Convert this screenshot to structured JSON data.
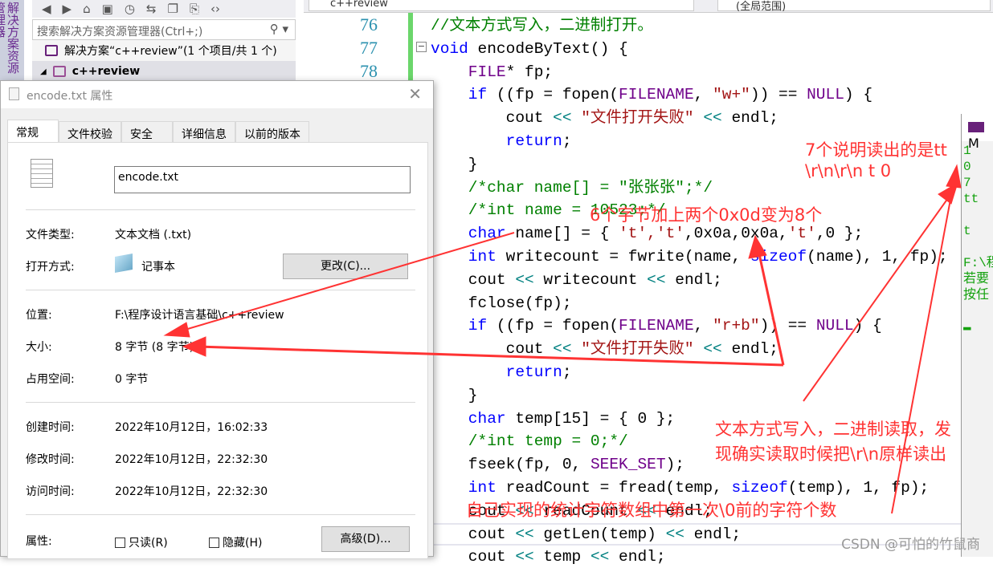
{
  "solution_explorer": {
    "side_label": "解决方案资源管理器",
    "toolbar_icons": [
      "back-icon",
      "forward-icon",
      "home-icon",
      "sync-view-icon",
      "history-icon",
      "switch-icon",
      "collapse-icon",
      "copy-icon",
      "code-icon"
    ],
    "search_placeholder": "搜索解决方案资源管理器(Ctrl+;)",
    "solution": "解决方案“c++review”(1 个项目/共 1 个)",
    "project": "c++review"
  },
  "editor": {
    "file_tab": "c++review",
    "scope": "(全局范围)",
    "line_numbers": [
      "76",
      "77",
      "78"
    ],
    "lines": [
      [
        {
          "t": "//文本方式写入，二进制打开。",
          "c": "c"
        }
      ],
      [
        {
          "t": "void",
          "c": "k"
        },
        {
          "t": " encodeByText() {",
          "c": ""
        }
      ],
      [
        {
          "t": "    FILE",
          "c": "m"
        },
        {
          "t": "* fp;",
          "c": ""
        }
      ],
      [
        {
          "t": "    if",
          "c": "k"
        },
        {
          "t": " ((fp = fopen(",
          "c": ""
        },
        {
          "t": "FILENAME",
          "c": "m"
        },
        {
          "t": ", ",
          "c": ""
        },
        {
          "t": "\"w+\"",
          "c": "s"
        },
        {
          "t": ")) == ",
          "c": ""
        },
        {
          "t": "NULL",
          "c": "m"
        },
        {
          "t": ") {",
          "c": ""
        }
      ],
      [
        {
          "t": "        cout ",
          "c": ""
        },
        {
          "t": "<<",
          "c": "o"
        },
        {
          "t": " \"文件打开失败\" ",
          "c": "s"
        },
        {
          "t": "<<",
          "c": "o"
        },
        {
          "t": " endl;",
          "c": ""
        }
      ],
      [
        {
          "t": "        return",
          "c": "k"
        },
        {
          "t": ";",
          "c": ""
        }
      ],
      [
        {
          "t": "    }",
          "c": ""
        }
      ],
      [
        {
          "t": "    /*char name[] = \"张张张\";*/",
          "c": "c"
        }
      ],
      [
        {
          "t": "    /*int name = 10523;*/",
          "c": "c"
        }
      ],
      [
        {
          "t": "    char",
          "c": "k"
        },
        {
          "t": " name[] = { ",
          "c": ""
        },
        {
          "t": "'t','t'",
          "c": "s"
        },
        {
          "t": ",0x0a,0x0a,",
          "c": ""
        },
        {
          "t": "'t'",
          "c": "s"
        },
        {
          "t": ",0 };",
          "c": ""
        }
      ],
      [
        {
          "t": "    int",
          "c": "k"
        },
        {
          "t": " writecount = fwrite(name, ",
          "c": ""
        },
        {
          "t": "sizeof",
          "c": "k"
        },
        {
          "t": "(name), 1, fp);",
          "c": ""
        }
      ],
      [
        {
          "t": "    cout ",
          "c": ""
        },
        {
          "t": "<<",
          "c": "o"
        },
        {
          "t": " writecount ",
          "c": ""
        },
        {
          "t": "<<",
          "c": "o"
        },
        {
          "t": " endl;",
          "c": ""
        }
      ],
      [
        {
          "t": "    fclose(fp);",
          "c": ""
        }
      ],
      [
        {
          "t": "    if",
          "c": "k"
        },
        {
          "t": " ((fp = fopen(",
          "c": ""
        },
        {
          "t": "FILENAME",
          "c": "m"
        },
        {
          "t": ", ",
          "c": ""
        },
        {
          "t": "\"r+b\"",
          "c": "s"
        },
        {
          "t": ")) == ",
          "c": ""
        },
        {
          "t": "NULL",
          "c": "m"
        },
        {
          "t": ") {",
          "c": ""
        }
      ],
      [
        {
          "t": "        cout ",
          "c": ""
        },
        {
          "t": "<<",
          "c": "o"
        },
        {
          "t": " \"文件打开失败\" ",
          "c": "s"
        },
        {
          "t": "<<",
          "c": "o"
        },
        {
          "t": " endl;",
          "c": ""
        }
      ],
      [
        {
          "t": "        return",
          "c": "k"
        },
        {
          "t": ";",
          "c": ""
        }
      ],
      [
        {
          "t": "    }",
          "c": ""
        }
      ],
      [
        {
          "t": "    char",
          "c": "k"
        },
        {
          "t": " temp[15] = { 0 };",
          "c": ""
        }
      ],
      [
        {
          "t": "    /*int temp = 0;*/",
          "c": "c"
        }
      ],
      [
        {
          "t": "    fseek(fp, 0, ",
          "c": ""
        },
        {
          "t": "SEEK_SET",
          "c": "m"
        },
        {
          "t": ");",
          "c": ""
        }
      ],
      [
        {
          "t": "    int",
          "c": "k"
        },
        {
          "t": " readCount = fread(temp, ",
          "c": ""
        },
        {
          "t": "sizeof",
          "c": "k"
        },
        {
          "t": "(temp), 1, fp);",
          "c": ""
        }
      ],
      [
        {
          "t": "    cout ",
          "c": ""
        },
        {
          "t": "<<",
          "c": "o"
        },
        {
          "t": " readCount ",
          "c": ""
        },
        {
          "t": "<<",
          "c": "o"
        },
        {
          "t": " endl;",
          "c": ""
        }
      ],
      [
        {
          "t": "    cout ",
          "c": ""
        },
        {
          "t": "<<",
          "c": "o"
        },
        {
          "t": " getLen(temp) ",
          "c": ""
        },
        {
          "t": "<<",
          "c": "o"
        },
        {
          "t": " endl;",
          "c": ""
        }
      ],
      [
        {
          "t": "    cout ",
          "c": ""
        },
        {
          "t": "<<",
          "c": "o"
        },
        {
          "t": " temp ",
          "c": ""
        },
        {
          "t": "<<",
          "c": "o"
        },
        {
          "t": " endl;",
          "c": ""
        }
      ]
    ]
  },
  "dialog": {
    "title": "encode.txt 属性",
    "tabs": [
      "常规",
      "文件校验",
      "安全",
      "详细信息",
      "以前的版本"
    ],
    "filename": "encode.txt",
    "type_label": "文件类型:",
    "type_value": "文本文档 (.txt)",
    "open_label": "打开方式:",
    "open_value": "记事本",
    "change_button": "更改(C)...",
    "location_label": "位置:",
    "location_value": "F:\\程序设计语言基础\\c++review",
    "size_label": "大小:",
    "size_value": "8 字节 (8 字节)",
    "disk_label": "占用空间:",
    "disk_value": "0 字节",
    "created_label": "创建时间:",
    "created_value": "2022年10月12日，16:02:33",
    "modified_label": "修改时间:",
    "modified_value": "2022年10月12日，22:32:30",
    "accessed_label": "访问时间:",
    "accessed_value": "2022年10月12日，22:32:30",
    "attr_label": "属性:",
    "readonly": "只读(R)",
    "hidden": "隐藏(H)",
    "advanced_button": "高级(D)..."
  },
  "console": {
    "title": "M",
    "output": "1\n0\n7\ntt\n\nt\n\nF:\\程\n若要\n按任\n\n▬"
  },
  "annotations": {
    "a1": "6个字节加上两个0x0d变为8个",
    "a2": "7个说明读出的是tt",
    "a3": "\\r\\n\\r\\n  t 0",
    "a4": "文本方式写入，二进制读取，发",
    "a5": "现确实读取时候把\\r\\n原样读出",
    "a6": "自己实现的统计字符数组中第一次\\0前的字符个数",
    "color": "#ff3333"
  },
  "watermark": "CSDN @可怕的竹鼠商"
}
